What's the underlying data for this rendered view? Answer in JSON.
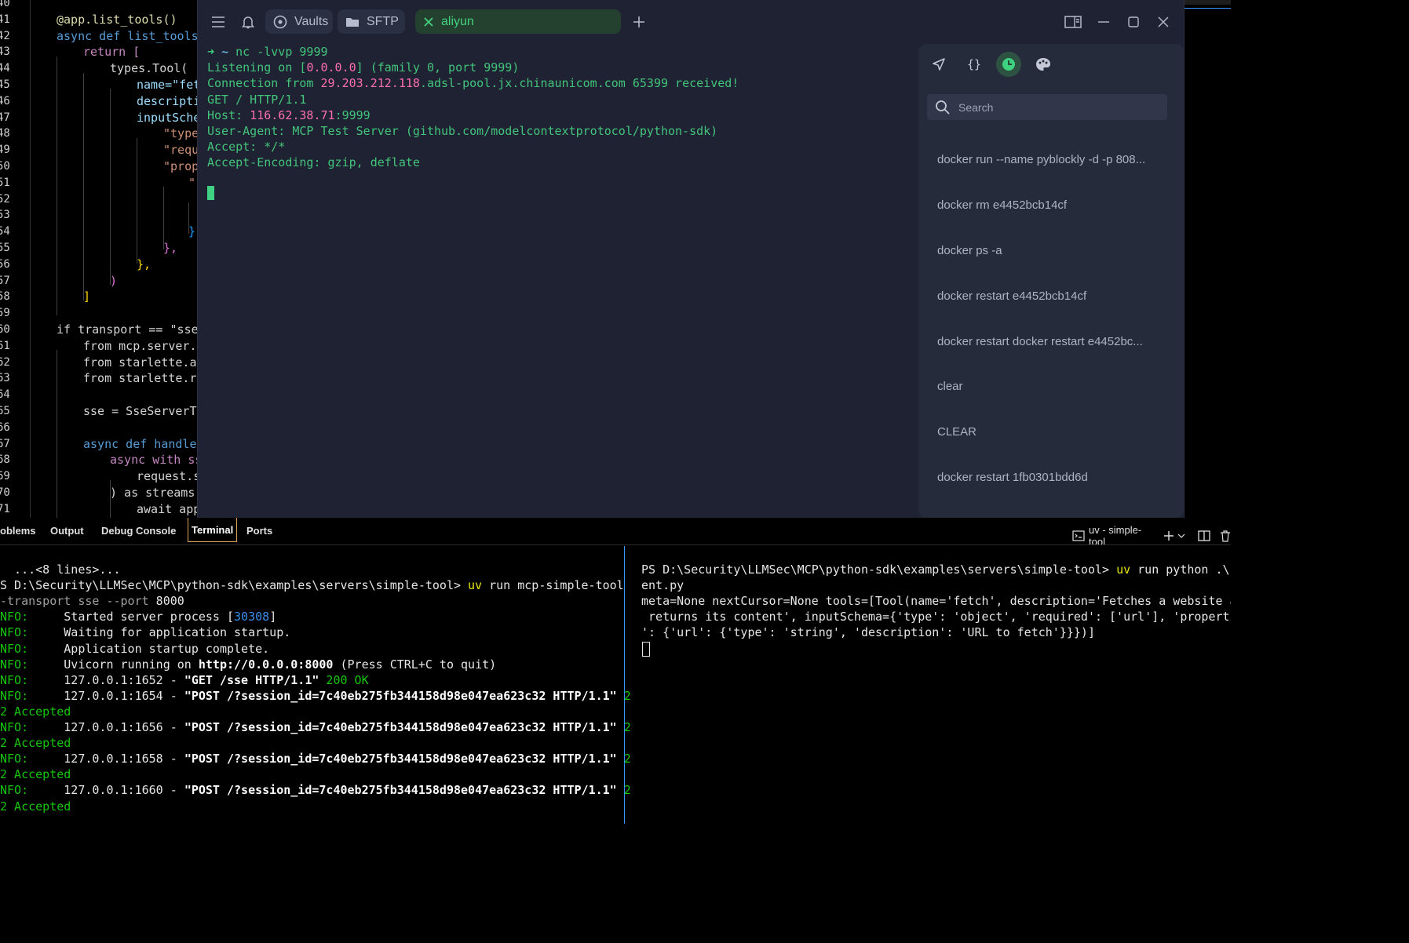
{
  "editor": {
    "line_numbers": [
      "40",
      "41",
      "42",
      "43",
      "44",
      "45",
      "46",
      "47",
      "48",
      "49",
      "50",
      "51",
      "52",
      "53",
      "54",
      "55",
      "56",
      "57",
      "58",
      "59",
      "60",
      "61",
      "62",
      "63",
      "64",
      "65",
      "66",
      "67",
      "68",
      "69",
      "70",
      "71"
    ],
    "lines": [
      "",
      "@app.list_tools()",
      "async def list_tools(",
      "return [",
      "types.Tool(",
      "name=\"fet",
      "descripti",
      "inputSchen",
      "\"type",
      "\"requ",
      "\"prope",
      "\"",
      "",
      "",
      "}",
      "},",
      "},",
      ")",
      "]",
      "",
      "if transport == \"sse\"",
      "from mcp.server.s",
      "from starlette.app",
      "from starlette.ro",
      "",
      "sse = SseServerTra",
      "",
      "async def handle_",
      "async with ss",
      "request.s",
      ") as streams:",
      "await app"
    ]
  },
  "app": {
    "tabs": [
      {
        "label": "Vaults",
        "icon": "vault-icon"
      },
      {
        "label": "SFTP",
        "icon": "folder-icon"
      },
      {
        "label": "aliyun",
        "icon": "close-icon",
        "active": true
      }
    ],
    "terminal": {
      "prompt_arrow": "➜",
      "prompt_dir": "~",
      "command": "nc -lvvp 9999",
      "l1_pre": "Listening on [",
      "l1_ip": "0.0.0.0",
      "l1_post": "] (family 0, port 9999)",
      "l2_pre": "Connection from ",
      "l2_ip": "29.203.212.118",
      "l2_post": ".adsl-pool.jx.chinaunicom.com 65399 received!",
      "l3": "GET / HTTP/1.1",
      "l4_pre": "Host: ",
      "l4_ip": "116.62.38.71",
      "l4_post": ":9999",
      "l5": "User-Agent: MCP Test Server (github.com/modelcontextprotocol/python-sdk)",
      "l6": "Accept: */*",
      "l7": "Accept-Encoding: gzip, deflate"
    },
    "panel": {
      "search_placeholder": "Search",
      "history": [
        "docker run --name pyblockly -d -p 808...",
        "docker rm e4452bcb14cf",
        "docker ps -a",
        "docker restart e4452bcb14cf",
        "docker restart docker restart e4452bc...",
        "clear",
        "CLEAR",
        "docker restart 1fb0301bdd6d"
      ]
    }
  },
  "bottom": {
    "tabs": [
      "oblems",
      "Output",
      "Debug Console",
      "Terminal",
      "Ports"
    ],
    "active_tab": "Terminal",
    "terminal_label": "uv - simple-tool",
    "left": {
      "l0": "  ...<8 lines>...",
      "l1_pre": "S D:\\Security\\LLMSec\\MCP\\python-sdk\\examples\\servers\\simple-tool> ",
      "l1_cmd": "uv",
      "l1_post": " run mcp-simple-tool",
      "l2_flag": "-transport sse --port",
      "l2_num": " 8000",
      "info": "NFO:",
      "l3_pre": "     Started server process [",
      "l3_num": "30308",
      "l3_post": "]",
      "l4": "     Waiting for application startup.",
      "l5": "     Application startup complete.",
      "l6_pre": "     Uvicorn running on ",
      "l6_url": "http://0.0.0.0:8000",
      "l6_post": " (Press CTRL+C to quit)",
      "l7_pre": "     127.0.0.1:1652 - ",
      "l7_req": "\"GET /sse HTTP/1.1\"",
      "l7_status": " 200 OK",
      "post_req": "\"POST /?session_id=7c40eb275fb344158d98e047ea623c32 HTTP/1.1\"",
      "post_tail": " 2",
      "accepted": "2 Accepted",
      "l8_pre": "     127.0.0.1:1654 - ",
      "l9_pre": "     127.0.0.1:1656 - ",
      "l10_pre": "     127.0.0.1:1658 - ",
      "l11_pre": "     127.0.0.1:1660 - "
    },
    "right": {
      "l1_pre": "PS D:\\Security\\LLMSec\\MCP\\python-sdk\\examples\\servers\\simple-tool> ",
      "l1_cmd": "uv",
      "l1_post": " run python .\\cli",
      "l2": "ent.py",
      "l3": "meta=None nextCursor=None tools=[Tool(name='fetch', description='Fetches a website and",
      "l4": " returns its content', inputSchema={'type': 'object', 'required': ['url'], 'properties",
      "l5": "': {'url': {'type': 'string', 'description': 'URL to fetch'}}})]"
    }
  },
  "colors": {
    "app_bg": "#1e2233",
    "accent_green": "#43c47a",
    "ip_pink": "#ff6fae",
    "vscode_blue": "#3794ff"
  }
}
